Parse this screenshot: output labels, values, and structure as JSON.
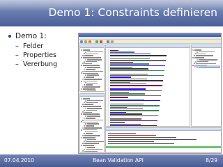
{
  "slide": {
    "title": "Demo 1: Constraints definieren",
    "bullets": {
      "main": "Demo 1:",
      "sub": [
        "Felder",
        "Properties",
        "Vererbung"
      ]
    }
  },
  "footer": {
    "date": "07.04.2010",
    "center": "Bean Validation API",
    "page": "8/29"
  },
  "colors": {
    "title_bar": "#5a6ea6",
    "footer_bar": "#5a6b9f",
    "text": "#1c1c1c",
    "ide_selection": "#b7d0f0",
    "console_progress": "#6fc46f"
  },
  "ide_screenshot": {
    "icons": [
      "package-icon",
      "class-icon",
      "method-icon",
      "field-icon"
    ]
  }
}
